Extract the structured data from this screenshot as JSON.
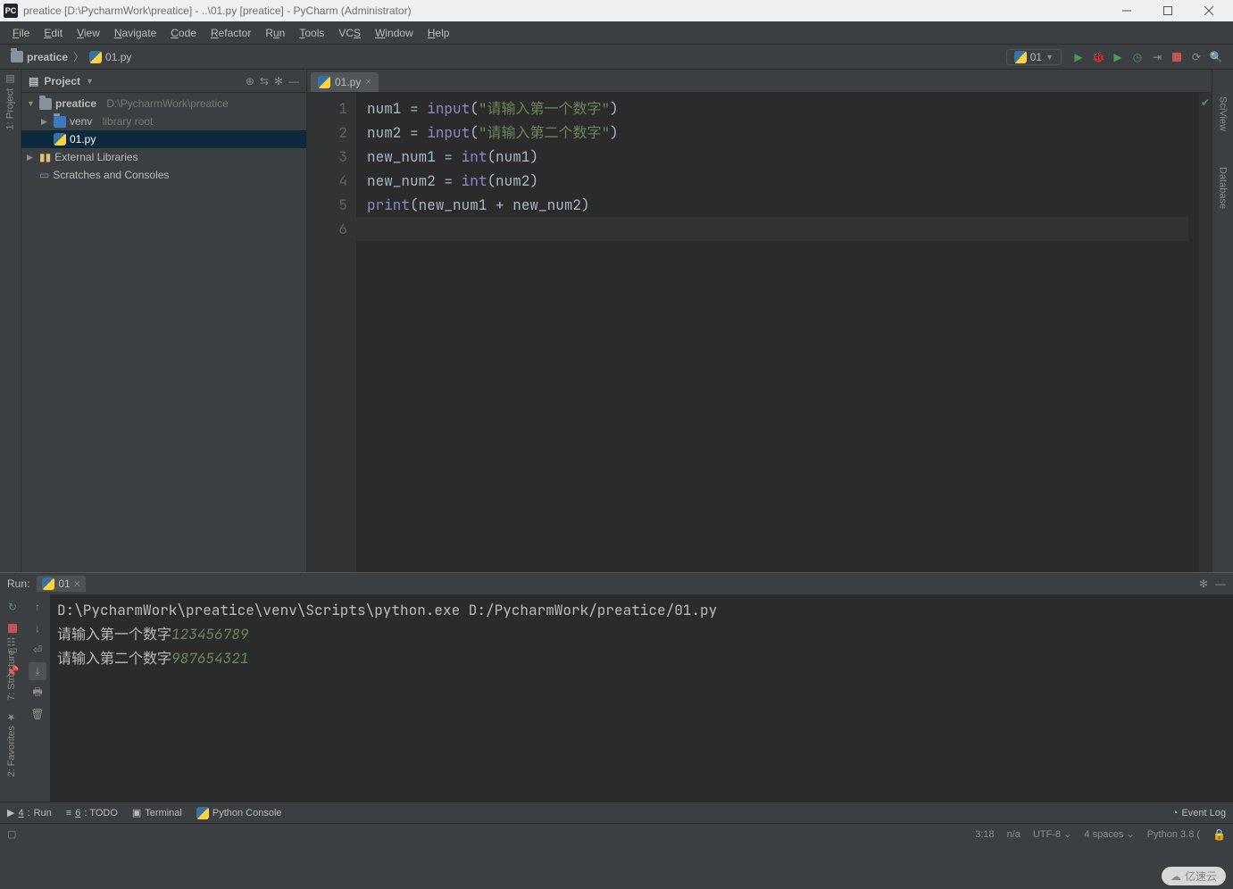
{
  "title": "preatice [D:\\PycharmWork\\preatice] - ..\\01.py [preatice] - PyCharm (Administrator)",
  "menubar": [
    "File",
    "Edit",
    "View",
    "Navigate",
    "Code",
    "Refactor",
    "Run",
    "Tools",
    "VCS",
    "Window",
    "Help"
  ],
  "breadcrumb": {
    "root": "preatice",
    "file": "01.py"
  },
  "run_config": {
    "label": "01"
  },
  "project": {
    "panel_title": "Project",
    "root_name": "preatice",
    "root_path": "D:\\PycharmWork\\preatice",
    "venv": "venv",
    "venv_hint": "library root",
    "file": "01.py",
    "extlib": "External Libraries",
    "scratches": "Scratches and Consoles"
  },
  "editor": {
    "tab": "01.py",
    "lines": [
      "1",
      "2",
      "3",
      "4",
      "5",
      "6"
    ],
    "l1": {
      "v": "num1",
      "eq": " = ",
      "fn": "input",
      "po": "(",
      "s": "\"请输入第一个数字\"",
      "pc": ")"
    },
    "l2": {
      "v": "num2",
      "eq": " = ",
      "fn": "input",
      "po": "(",
      "s": "\"请输入第二个数字\"",
      "pc": ")"
    },
    "l3": {
      "v": "new_num1",
      "eq": " = ",
      "fn": "int",
      "po": "(",
      "a": "num1",
      "pc": ")"
    },
    "l4": {
      "v": "new_num2",
      "eq": " = ",
      "fn": "int",
      "po": "(",
      "a": "num2",
      "pc": ")"
    },
    "l5": {
      "fn": "print",
      "po": "(",
      "a": "new_num1 + new_num2",
      "pc": ")"
    }
  },
  "run": {
    "title": "Run:",
    "tab": "01",
    "cmd": "D:\\PycharmWork\\preatice\\venv\\Scripts\\python.exe D:/PycharmWork/preatice/01.py",
    "p1": "请输入第一个数字",
    "i1": "123456789",
    "p2": "请输入第二个数字",
    "i2": "987654321"
  },
  "left_tools": {
    "project": "1: Project",
    "structure": "7: Structure",
    "favorites": "2: Favorites"
  },
  "right_tools": {
    "scivew": "SciView",
    "database": "Database"
  },
  "bottom": {
    "run": "4: Run",
    "todo": "6: TODO",
    "terminal": "Terminal",
    "pyconsole": "Python Console",
    "eventlog": "Event Log"
  },
  "status": {
    "pos": "3:18",
    "na": "n/a",
    "enc": "UTF-8",
    "indent": "4 spaces",
    "interp": "Python 3.8 (",
    "watermark": "亿速云"
  }
}
